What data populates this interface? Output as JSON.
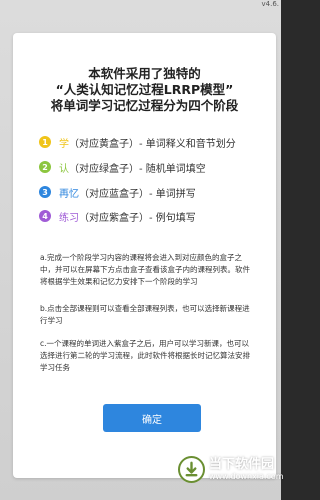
{
  "version": "v4.6.",
  "title_lines": [
    "本软件采用了独特的",
    "“人类认知记忆过程LRRP模型”",
    "将单词学习记忆过程分为四个阶段"
  ],
  "stages": [
    {
      "num": "1",
      "key": "学",
      "rest": "（对应黄盒子）- 单词释义和音节划分",
      "color": "#f0c419"
    },
    {
      "num": "2",
      "key": "认",
      "rest": "（对应绿盒子）- 随机单词填空",
      "color": "#8cc63f"
    },
    {
      "num": "3",
      "key": "再忆",
      "rest": "（对应蓝盒子）- 单词拼写",
      "color": "#2e86de"
    },
    {
      "num": "4",
      "key": "练习",
      "rest": "（对应紫盒子）- 例句填写",
      "color": "#a05cd6"
    }
  ],
  "notes": [
    "a.完成一个阶段学习内容的课程将会进入到对应颜色的盒子之中，并可以在屏幕下方点击盒子查看该盒子内的课程列表。软件将根据学生效果和记忆力安排下一个阶段的学习",
    "b.点击全部课程则可以查看全部课程列表，也可以选择新课程进行学习",
    "c.一个课程的单词进入紫盒子之后，用户可以学习新课，也可以选择进行第二轮的学习流程，此时软件将根据长时记忆算法安排学习任务"
  ],
  "confirm_label": "确定",
  "watermark": {
    "name": "当下软件园",
    "url": "www.downxia.com"
  }
}
